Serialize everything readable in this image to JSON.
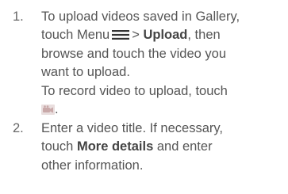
{
  "steps": [
    {
      "number": "1.",
      "l1": "To upload videos saved in Gallery,",
      "l2_pre": "touch Menu",
      "l2_gt": ">",
      "l2_bold": "Upload",
      "l2_post": ", then",
      "l3": "browse and touch the video you",
      "l4": "want to upload.",
      "l5": "To record video to upload, touch",
      "l6_post": ".",
      "menu_icon": "menu-icon",
      "camera_icon": "video-camera-icon"
    },
    {
      "number": "2.",
      "l1": "Enter a video title. If necessary,",
      "l2_pre": "touch",
      "l2_bold": "More details",
      "l2_post": "and enter",
      "l3": "other information."
    }
  ],
  "colors": {
    "text": "#555555",
    "bold": "#444444",
    "icon": "#c9a9a9"
  }
}
